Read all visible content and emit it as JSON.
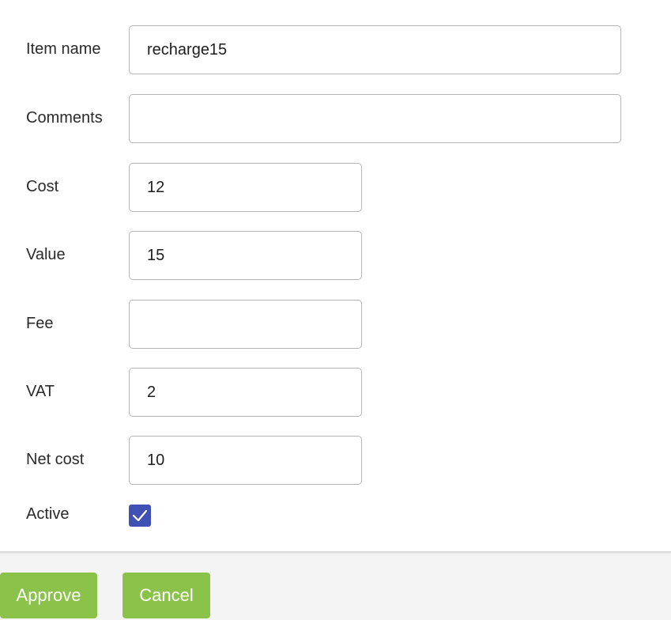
{
  "form": {
    "fields": {
      "item_name": {
        "label": "Item name",
        "value": "recharge15"
      },
      "comments": {
        "label": "Comments",
        "value": ""
      },
      "cost": {
        "label": "Cost",
        "value": "12"
      },
      "value": {
        "label": "Value",
        "value": "15"
      },
      "fee": {
        "label": "Fee",
        "value": ""
      },
      "vat": {
        "label": "VAT",
        "value": "2"
      },
      "net_cost": {
        "label": "Net cost",
        "value": "10"
      }
    },
    "active": {
      "label": "Active",
      "checked": true
    }
  },
  "actions": {
    "approve_label": "Approve",
    "cancel_label": "Cancel"
  },
  "colors": {
    "checkbox": "#3f51b5",
    "button": "#8bc34a"
  }
}
